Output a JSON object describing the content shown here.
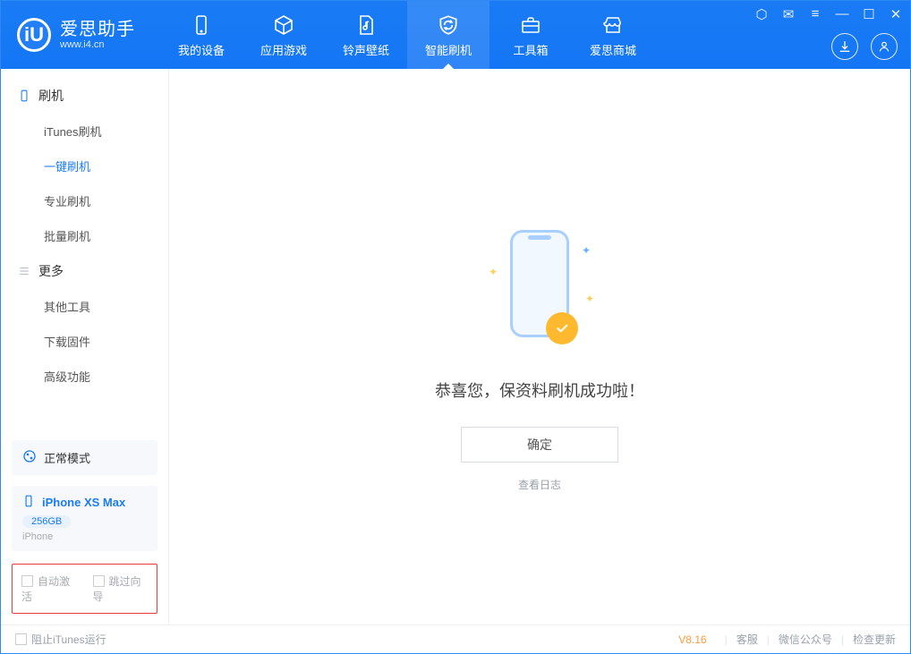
{
  "app": {
    "name": "爱思助手",
    "site": "www.i4.cn"
  },
  "nav": {
    "items": [
      {
        "label": "我的设备"
      },
      {
        "label": "应用游戏"
      },
      {
        "label": "铃声壁纸"
      },
      {
        "label": "智能刷机"
      },
      {
        "label": "工具箱"
      },
      {
        "label": "爱思商城"
      }
    ]
  },
  "sidebar": {
    "section_flash": "刷机",
    "flash_items": [
      "iTunes刷机",
      "一键刷机",
      "专业刷机",
      "批量刷机"
    ],
    "section_more": "更多",
    "more_items": [
      "其他工具",
      "下载固件",
      "高级功能"
    ],
    "mode_label": "正常模式",
    "device": {
      "name": "iPhone XS Max",
      "storage": "256GB",
      "type": "iPhone"
    },
    "option_auto_activate": "自动激活",
    "option_skip_guide": "跳过向导"
  },
  "main": {
    "title": "恭喜您，保资料刷机成功啦！",
    "confirm": "确定",
    "view_log": "查看日志"
  },
  "footer": {
    "block_itunes": "阻止iTunes运行",
    "version": "V8.16",
    "links": [
      "客服",
      "微信公众号",
      "检查更新"
    ]
  }
}
